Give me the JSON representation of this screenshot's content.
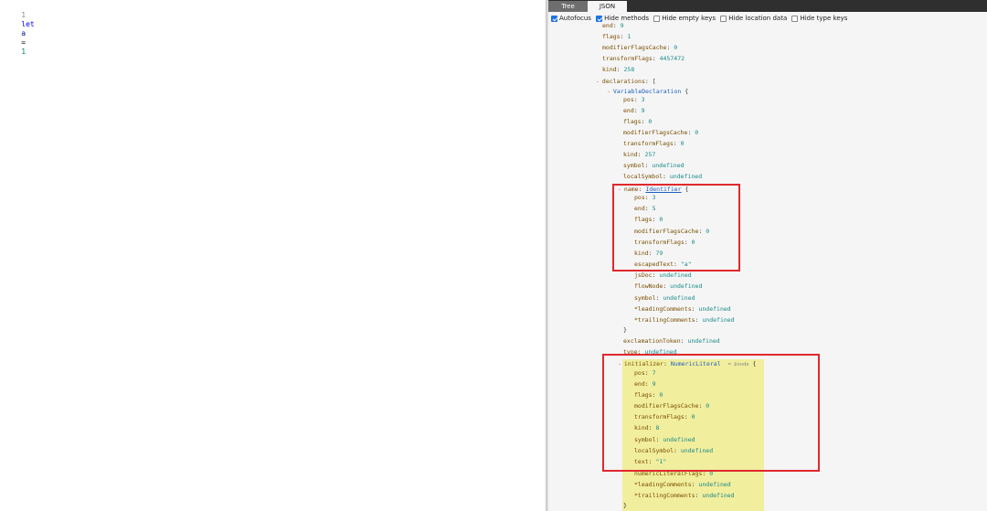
{
  "editor": {
    "line_number": "1",
    "code_keyword": "let",
    "code_ident": "a",
    "code_op": "=",
    "code_num": "1"
  },
  "inspector": {
    "tabs": [
      {
        "label": "Tree",
        "active": true
      },
      {
        "label": "JSON",
        "active": false
      }
    ],
    "options": [
      {
        "label": "Autofocus",
        "checked": true
      },
      {
        "label": "Hide methods",
        "checked": true
      },
      {
        "label": "Hide empty keys",
        "checked": false
      },
      {
        "label": "Hide location data",
        "checked": false
      },
      {
        "label": "Hide type keys",
        "checked": false
      }
    ]
  },
  "tree": {
    "top": {
      "end": {
        "key": "end",
        "value": "9"
      },
      "flags": {
        "key": "flags",
        "value": "1"
      },
      "modifierFlagsCache": {
        "key": "modifierFlagsCache",
        "value": "0"
      },
      "transformFlags": {
        "key": "transformFlags",
        "value": "4457472"
      },
      "kind": {
        "key": "kind",
        "value": "258"
      },
      "declarations": {
        "key": "declarations",
        "bracket": "["
      }
    },
    "vardecl": {
      "type": "VariableDeclaration",
      "brace": "{",
      "pos": {
        "key": "pos",
        "value": "3"
      },
      "end": {
        "key": "end",
        "value": "9"
      },
      "flags": {
        "key": "flags",
        "value": "0"
      },
      "modifierFlagsCache": {
        "key": "modifierFlagsCache",
        "value": "0"
      },
      "transformFlags": {
        "key": "transformFlags",
        "value": "0"
      },
      "kind": {
        "key": "kind",
        "value": "257"
      },
      "symbol": {
        "key": "symbol",
        "value": "undefined"
      },
      "localSymbol": {
        "key": "localSymbol",
        "value": "undefined"
      },
      "exclamationToken": {
        "key": "exclamationToken",
        "value": "undefined"
      },
      "typeKey": {
        "key": "type",
        "value": "undefined"
      }
    },
    "name": {
      "key": "name",
      "type": "Identifier",
      "brace": "{",
      "pos": {
        "key": "pos",
        "value": "3"
      },
      "end": {
        "key": "end",
        "value": "5"
      },
      "flags": {
        "key": "flags",
        "value": "0"
      },
      "modifierFlagsCache": {
        "key": "modifierFlagsCache",
        "value": "0"
      },
      "transformFlags": {
        "key": "transformFlags",
        "value": "0"
      },
      "kind": {
        "key": "kind",
        "value": "79"
      },
      "escapedText": {
        "key": "escapedText",
        "value": "\"a\""
      },
      "jsDoc": {
        "key": "jsDoc",
        "value": "undefined"
      },
      "flowNode": {
        "key": "flowNode",
        "value": "undefined"
      },
      "symbol": {
        "key": "symbol",
        "value": "undefined"
      },
      "leadingComments": {
        "key": "*leadingComments",
        "value": "undefined"
      },
      "trailingComments": {
        "key": "*trailingComments",
        "value": "undefined"
      },
      "close": "}"
    },
    "initializer": {
      "key": "initializer",
      "type": "NumericLiteral",
      "meta": "= $node",
      "brace": "{",
      "pos": {
        "key": "pos",
        "value": "7"
      },
      "end": {
        "key": "end",
        "value": "9"
      },
      "flags": {
        "key": "flags",
        "value": "0"
      },
      "modifierFlagsCache": {
        "key": "modifierFlagsCache",
        "value": "0"
      },
      "transformFlags": {
        "key": "transformFlags",
        "value": "0"
      },
      "kind": {
        "key": "kind",
        "value": "8"
      },
      "symbol": {
        "key": "symbol",
        "value": "undefined"
      },
      "localSymbol": {
        "key": "localSymbol",
        "value": "undefined"
      },
      "text": {
        "key": "text",
        "value": "\"1\""
      },
      "numericLiteralFlags": {
        "key": "numericLiteralFlags",
        "value": "0"
      },
      "leadingComments": {
        "key": "*leadingComments",
        "value": "undefined"
      },
      "trailingComments": {
        "key": "*trailingComments",
        "value": "undefined"
      },
      "close": "}"
    },
    "toggle_glyph": "-",
    "colon": ":"
  }
}
